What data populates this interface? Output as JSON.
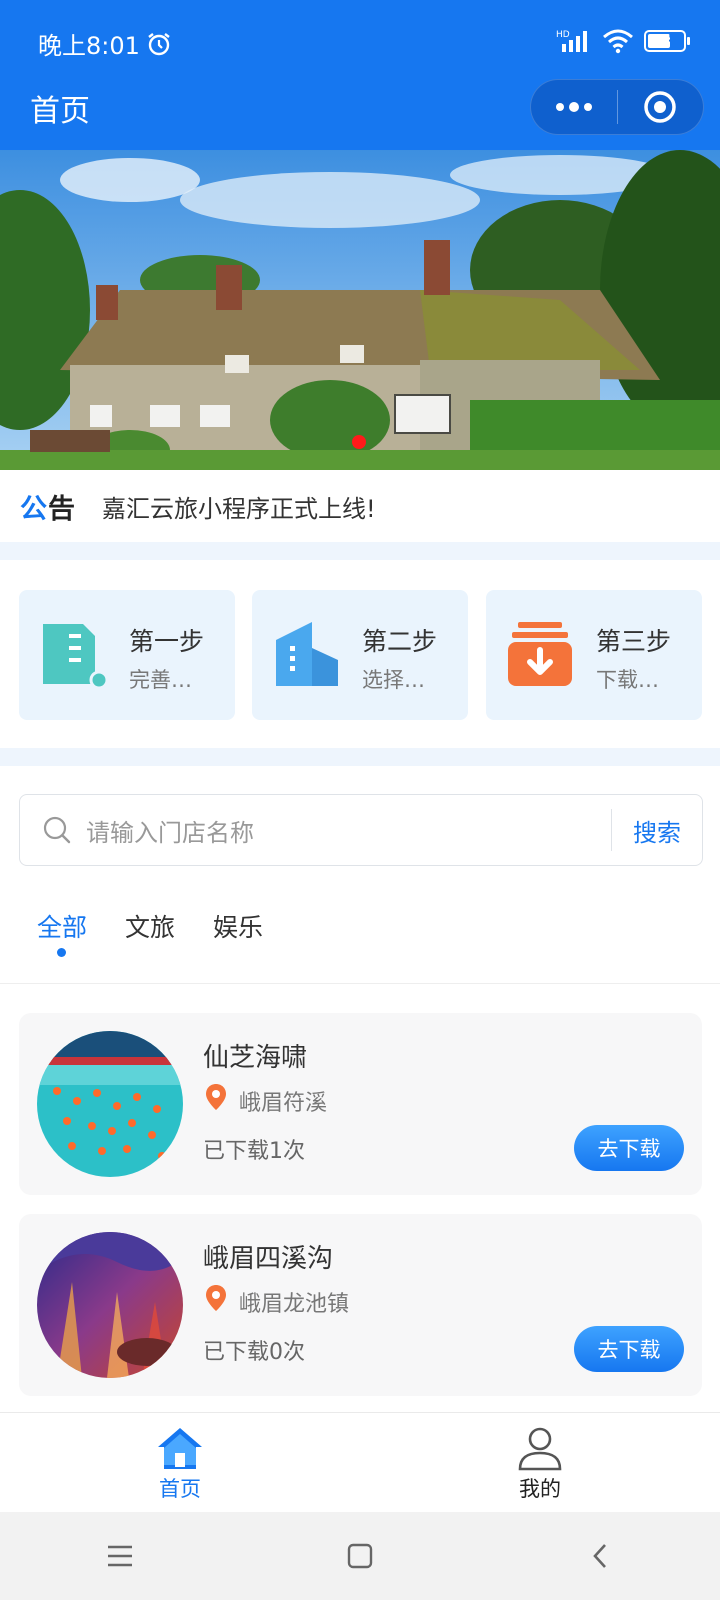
{
  "status_bar": {
    "time": "晚上8:01",
    "battery": "5",
    "network": "HD"
  },
  "nav": {
    "title": "首页"
  },
  "notice": {
    "label_part1": "公",
    "label_part2": "告",
    "text": "嘉汇云旅小程序正式上线!"
  },
  "steps": [
    {
      "title": "第一步",
      "desc": "完善…",
      "icon": "document-icon",
      "color": "#4ec7c1"
    },
    {
      "title": "第二步",
      "desc": "选择…",
      "icon": "building-icon",
      "color": "#4aa8ee"
    },
    {
      "title": "第三步",
      "desc": "下载…",
      "icon": "download-box-icon",
      "color": "#f4733a"
    }
  ],
  "search": {
    "placeholder": "请输入门店名称",
    "button": "搜索"
  },
  "tabs": [
    {
      "label": "全部",
      "active": true
    },
    {
      "label": "文旅",
      "active": false
    },
    {
      "label": "娱乐",
      "active": false
    }
  ],
  "stores": [
    {
      "name": "仙芝海啸",
      "location": "峨眉符溪",
      "downloads": "已下载1次",
      "button": "去下载"
    },
    {
      "name": "峨眉四溪沟",
      "location": "峨眉龙池镇",
      "downloads": "已下载0次",
      "button": "去下载"
    }
  ],
  "tabbar": [
    {
      "label": "首页",
      "active": true,
      "icon": "home-icon"
    },
    {
      "label": "我的",
      "active": false,
      "icon": "user-icon"
    }
  ],
  "colors": {
    "primary": "#1677f0",
    "orange_pin": "#f4733a",
    "banner_dot": "#ff1a1a"
  }
}
